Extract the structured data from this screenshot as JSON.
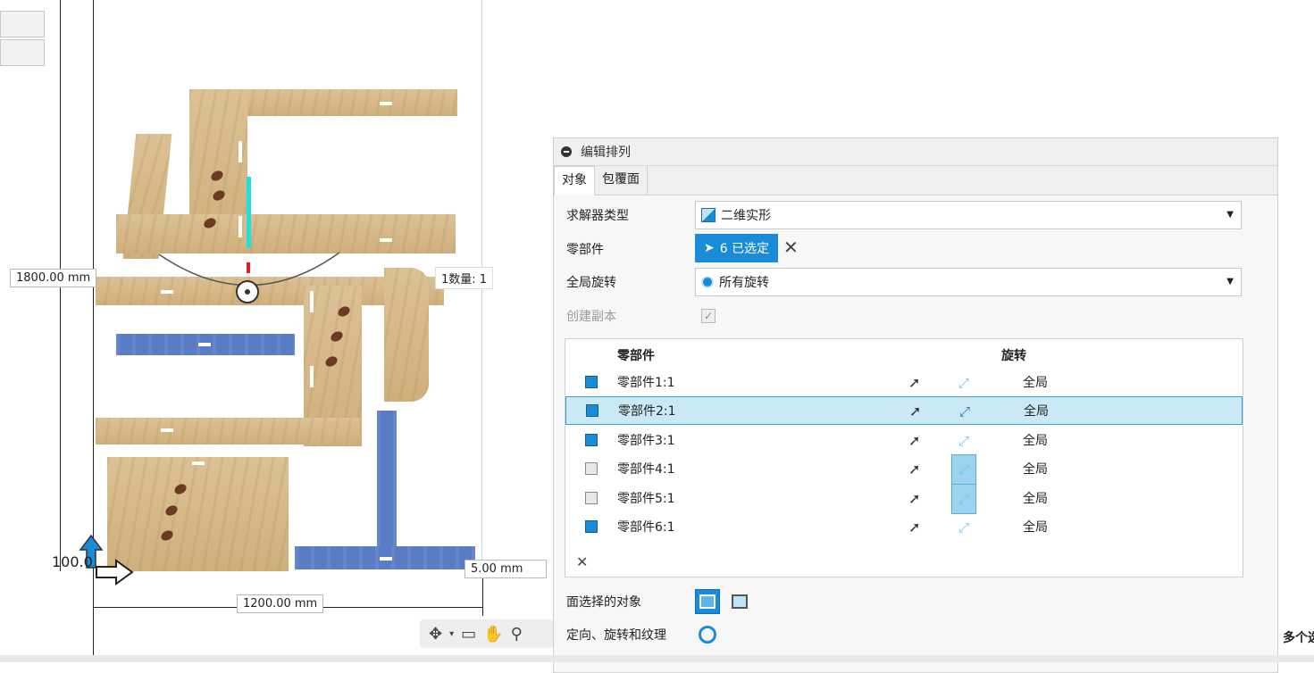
{
  "canvas": {
    "dim_height": "1800.00 mm",
    "dim_width": "1200.00 mm",
    "dim_spacing": "5.00 mm",
    "quantity_label": "1数量: 1",
    "origin_value": "100.0"
  },
  "panel": {
    "title": "编辑排列",
    "tabs": [
      {
        "label": "对象"
      },
      {
        "label": "包覆面"
      }
    ],
    "solver_type": {
      "label": "求解器类型",
      "value": "二维实形"
    },
    "components": {
      "label": "零部件",
      "selected_text": "6 已选定"
    },
    "global_rotation": {
      "label": "全局旋转",
      "value": "所有旋转"
    },
    "create_copy": {
      "label": "创建副本"
    },
    "table": {
      "headers": {
        "component": "零部件",
        "rotation": "旋转"
      },
      "rows": [
        {
          "name": "零部件1:1",
          "rotation": "全局"
        },
        {
          "name": "零部件2:1",
          "rotation": "全局"
        },
        {
          "name": "零部件3:1",
          "rotation": "全局"
        },
        {
          "name": "零部件4:1",
          "rotation": "全局"
        },
        {
          "name": "零部件5:1",
          "rotation": "全局"
        },
        {
          "name": "零部件6:1",
          "rotation": "全局"
        }
      ]
    },
    "face_select": {
      "label": "面选择的对象"
    },
    "orient": {
      "label": "定向、旋转和纹理"
    }
  },
  "right_edge_text": "多个选",
  "colors": {
    "accent": "#1a8bd6",
    "selected_row": "#cbe8f5"
  }
}
